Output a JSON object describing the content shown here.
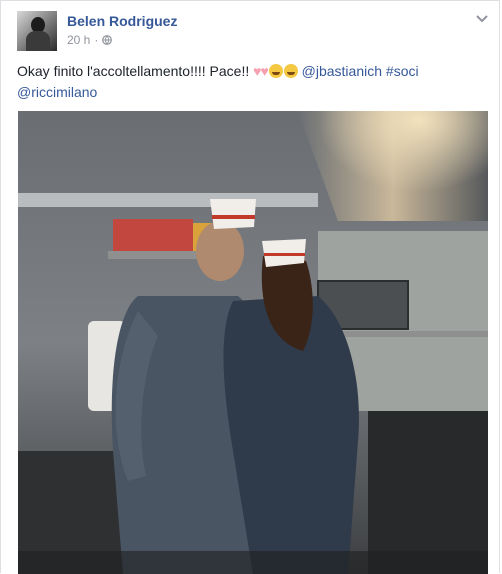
{
  "post": {
    "author": "Belen Rodriguez",
    "time": "20 h",
    "separator": "·",
    "text_main": "Okay finito l'accoltellamento!!!! Pace!! ",
    "hearts": "♥♥",
    "mention_1": "@jbastianich",
    "hashtag": "#soci",
    "mention_2": "@riccimilano"
  },
  "icons": {
    "privacy": "globe-icon",
    "options": "chevron-down-icon",
    "emoji": "grinning-face-icon"
  },
  "colors": {
    "link": "#365899",
    "text": "#1d2129",
    "meta": "#90949c"
  }
}
